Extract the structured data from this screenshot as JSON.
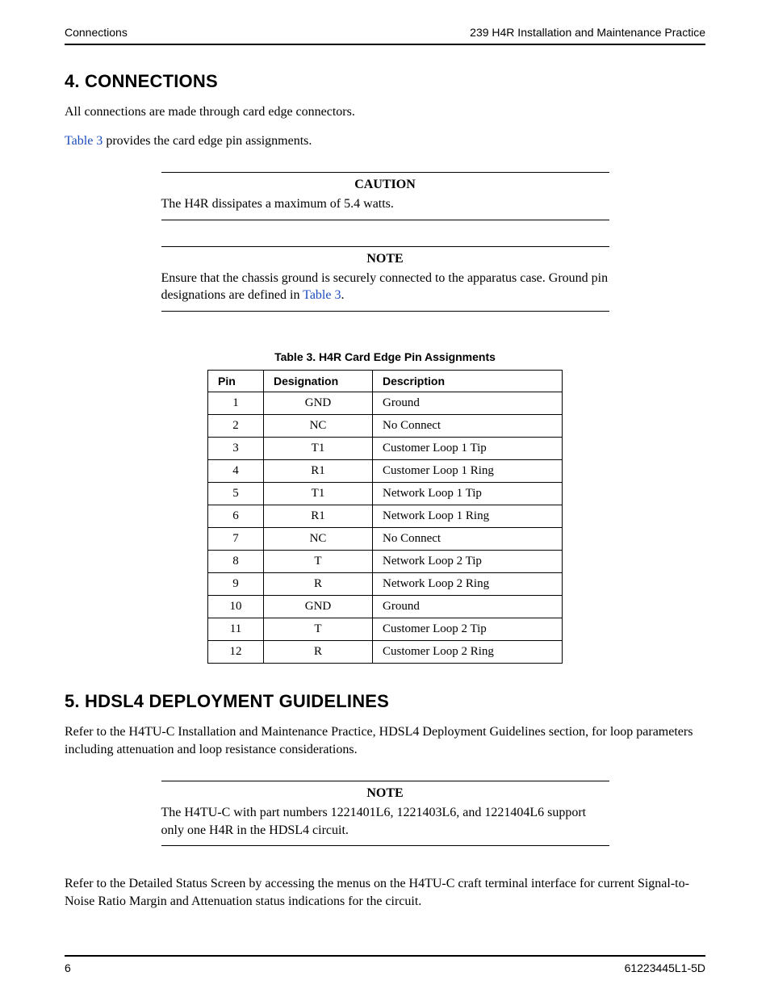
{
  "header": {
    "left": "Connections",
    "right": "239 H4R Installation and Maintenance Practice"
  },
  "section4": {
    "heading": "4.   CONNECTIONS",
    "p1": "All connections are made through card edge connectors.",
    "p2_link": "Table 3",
    "p2_rest": " provides the card edge pin assignments."
  },
  "caution": {
    "title": "CAUTION",
    "body": "The H4R dissipates a maximum of 5.4 watts."
  },
  "note1": {
    "title": "NOTE",
    "body_pre": "Ensure that the chassis ground is securely connected to the apparatus case. Ground pin designations are defined in ",
    "body_link": "Table 3",
    "body_post": "."
  },
  "table": {
    "caption": "Table 3.  H4R Card Edge Pin Assignments",
    "headers": {
      "pin": "Pin",
      "designation": "Designation",
      "description": "Description"
    },
    "rows": [
      {
        "pin": "1",
        "designation": "GND",
        "description": "Ground"
      },
      {
        "pin": "2",
        "designation": "NC",
        "description": "No Connect"
      },
      {
        "pin": "3",
        "designation": "T1",
        "description": "Customer Loop 1 Tip"
      },
      {
        "pin": "4",
        "designation": "R1",
        "description": "Customer Loop 1 Ring"
      },
      {
        "pin": "5",
        "designation": "T1",
        "description": "Network Loop 1 Tip"
      },
      {
        "pin": "6",
        "designation": "R1",
        "description": "Network Loop 1 Ring"
      },
      {
        "pin": "7",
        "designation": "NC",
        "description": "No Connect"
      },
      {
        "pin": "8",
        "designation": "T",
        "description": "Network Loop 2 Tip"
      },
      {
        "pin": "9",
        "designation": "R",
        "description": "Network Loop 2 Ring"
      },
      {
        "pin": "10",
        "designation": "GND",
        "description": "Ground"
      },
      {
        "pin": "11",
        "designation": "T",
        "description": "Customer Loop 2 Tip"
      },
      {
        "pin": "12",
        "designation": "R",
        "description": "Customer Loop 2 Ring"
      }
    ]
  },
  "section5": {
    "heading": "5.   HDSL4 DEPLOYMENT GUIDELINES",
    "p1": "Refer to the H4TU-C Installation and Maintenance Practice, HDSL4 Deployment Guidelines section, for loop parameters including attenuation and loop resistance considerations."
  },
  "note2": {
    "title": "NOTE",
    "body": "The H4TU-C with part numbers 1221401L6, 1221403L6, and 1221404L6 support only one H4R in the HDSL4 circuit."
  },
  "closing": {
    "p": "Refer to the Detailed Status Screen by accessing the menus on the H4TU-C craft terminal interface for current Signal-to-Noise Ratio Margin and Attenuation status indications for the circuit."
  },
  "footer": {
    "left": "6",
    "right": "61223445L1-5D"
  }
}
